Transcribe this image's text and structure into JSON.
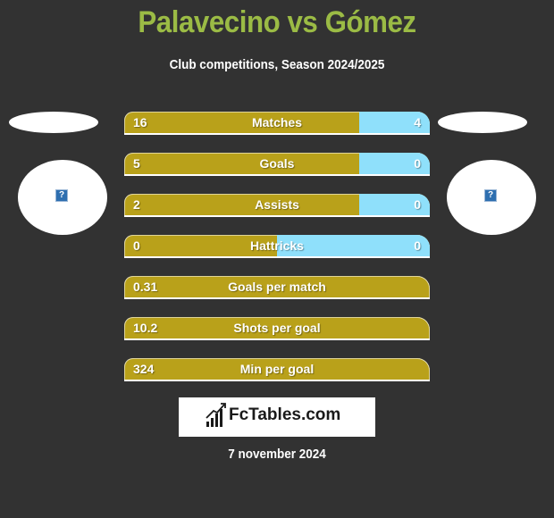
{
  "header": {
    "title": "Palavecino vs Gómez",
    "subtitle": "Club competitions, Season 2024/2025"
  },
  "players": {
    "left": {
      "name": "Palavecino",
      "avatar_icon": "missing-image-icon"
    },
    "right": {
      "name": "Gómez",
      "avatar_icon": "missing-image-icon"
    }
  },
  "colors": {
    "background": "#323232",
    "title": "#9bbb45",
    "left_bar": "#b9a11a",
    "right_bar": "#8fe0fb"
  },
  "stats": [
    {
      "label": "Matches",
      "left": "16",
      "right": "4",
      "right_share": 0.23
    },
    {
      "label": "Goals",
      "left": "5",
      "right": "0",
      "right_share": 0.23
    },
    {
      "label": "Assists",
      "left": "2",
      "right": "0",
      "right_share": 0.23
    },
    {
      "label": "Hattricks",
      "left": "0",
      "right": "0",
      "right_share": 0.5
    },
    {
      "label": "Goals per match",
      "left": "0.31",
      "right": null,
      "right_share": 0
    },
    {
      "label": "Shots per goal",
      "left": "10.2",
      "right": null,
      "right_share": 0
    },
    {
      "label": "Min per goal",
      "left": "324",
      "right": null,
      "right_share": 0
    }
  ],
  "footer": {
    "logo_text": "FcTables.com",
    "logo_icon": "bar-chart-icon",
    "date": "7 november 2024"
  }
}
